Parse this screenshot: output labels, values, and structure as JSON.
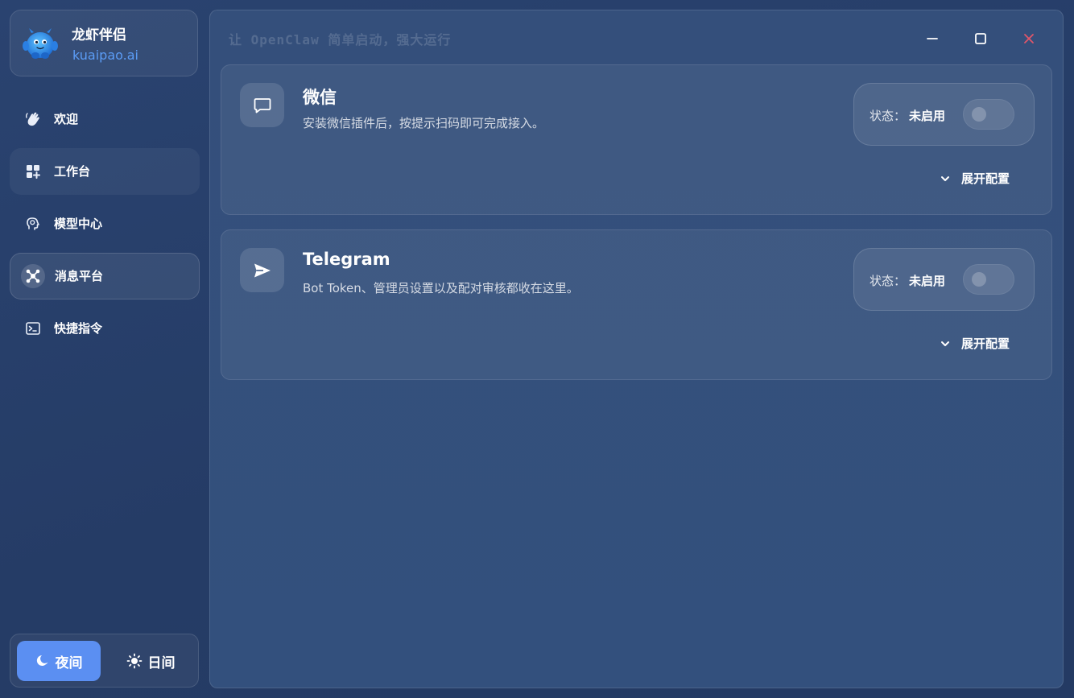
{
  "brand": {
    "name": "龙虾伴侣",
    "site": "kuaipao.ai",
    "logo_icon": "mascot-logo-icon"
  },
  "sidebar": {
    "items": [
      {
        "label": "欢迎",
        "icon": "clap-hands-icon",
        "state": "normal"
      },
      {
        "label": "工作台",
        "icon": "dashboard-grid-icon",
        "state": "soft"
      },
      {
        "label": "模型中心",
        "icon": "brain-head-icon",
        "state": "normal"
      },
      {
        "label": "消息平台",
        "icon": "network-hub-icon",
        "state": "active"
      },
      {
        "label": "快捷指令",
        "icon": "terminal-icon",
        "state": "normal"
      }
    ]
  },
  "theme": {
    "night_label": "夜间",
    "day_label": "日间",
    "selected": "night"
  },
  "header": {
    "tagline": "让 OpenClaw 简单启动，强大运行"
  },
  "window_controls": {
    "minimize_icon": "minimize-icon",
    "maximize_icon": "maximize-icon",
    "close_icon": "close-icon"
  },
  "cards": [
    {
      "title": "微信",
      "description": "安装微信插件后，按提示扫码即可完成接入。",
      "icon": "chat-bubble-icon",
      "status_label": "状态：",
      "status_value": "未启用",
      "enabled": false,
      "expand_label": "展开配置"
    },
    {
      "title": "Telegram",
      "description": "Bot Token、管理员设置以及配对审核都收在这里。",
      "icon": "send-plane-icon",
      "status_label": "状态：",
      "status_value": "未启用",
      "enabled": false,
      "expand_label": "展开配置"
    }
  ],
  "colors": {
    "accent": "#5b8ff2",
    "link": "#5b9cf5",
    "close": "#e0566a",
    "background": "#263d66"
  }
}
